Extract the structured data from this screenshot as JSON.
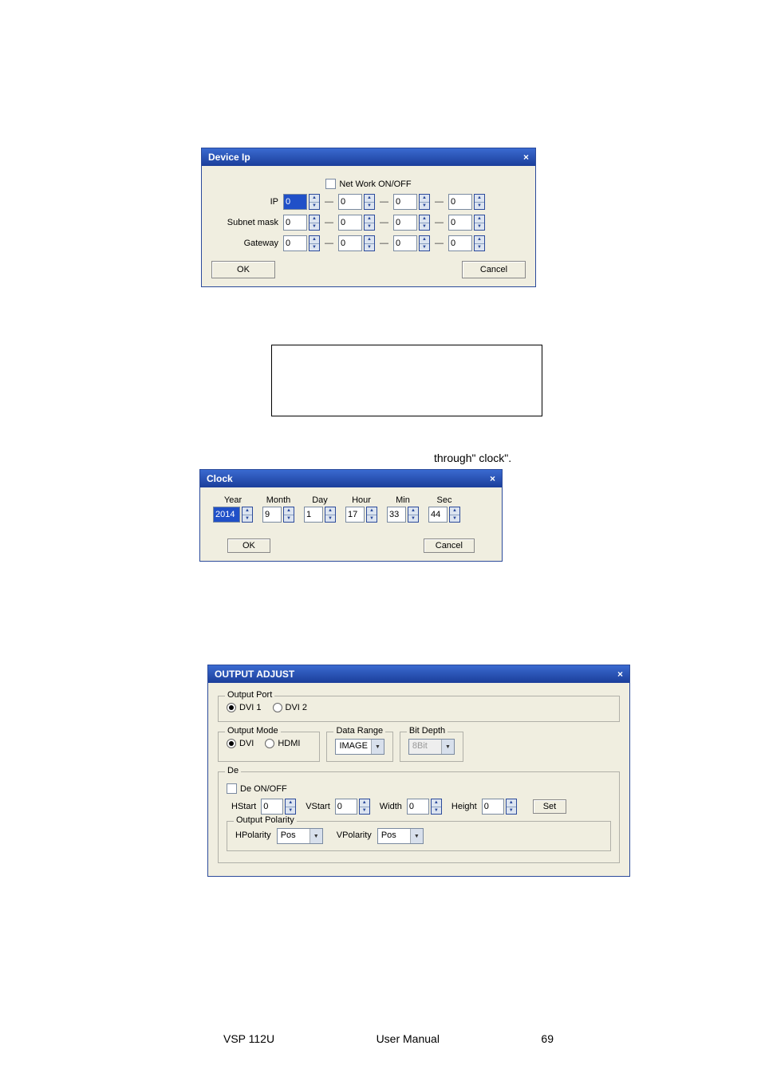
{
  "device_ip": {
    "title": "Device Ip",
    "network_label": "Net Work ON/OFF",
    "network_checked": false,
    "rows": [
      {
        "label": "IP",
        "values": [
          "0",
          "0",
          "0",
          "0"
        ],
        "highlight_first": true
      },
      {
        "label": "Subnet mask",
        "values": [
          "0",
          "0",
          "0",
          "0"
        ],
        "highlight_first": false
      },
      {
        "label": "Gateway",
        "values": [
          "0",
          "0",
          "0",
          "0"
        ],
        "highlight_first": false
      }
    ],
    "ok": "OK",
    "cancel": "Cancel"
  },
  "line_text": "through\" clock\".",
  "clock": {
    "title": "Clock",
    "cols": [
      {
        "label": "Year",
        "value": "2014",
        "highlight": true
      },
      {
        "label": "Month",
        "value": "9"
      },
      {
        "label": "Day",
        "value": "1"
      },
      {
        "label": "Hour",
        "value": "17"
      },
      {
        "label": "Min",
        "value": "33"
      },
      {
        "label": "Sec",
        "value": "44"
      }
    ],
    "ok": "OK",
    "cancel": "Cancel"
  },
  "output_adjust": {
    "title": "OUTPUT ADJUST",
    "output_port": {
      "legend": "Output Port",
      "options": [
        {
          "label": "DVI 1",
          "selected": true
        },
        {
          "label": "DVI 2",
          "selected": false
        }
      ]
    },
    "output_mode": {
      "legend": "Output Mode",
      "options": [
        {
          "label": "DVI",
          "selected": true
        },
        {
          "label": "HDMI",
          "selected": false
        }
      ]
    },
    "data_range": {
      "legend": "Data Range",
      "value": "IMAGE"
    },
    "bit_depth": {
      "legend": "Bit Depth",
      "value": "8Bit",
      "disabled": true
    },
    "de": {
      "legend": "De",
      "onoff_label": "De ON/OFF",
      "onoff_checked": false,
      "fields": [
        {
          "label": "HStart",
          "value": "0"
        },
        {
          "label": "VStart",
          "value": "0"
        },
        {
          "label": "Width",
          "value": "0"
        },
        {
          "label": "Height",
          "value": "0"
        }
      ],
      "set": "Set",
      "polarity": {
        "legend": "Output Polarity",
        "h_label": "HPolarity",
        "h_value": "Pos",
        "v_label": "VPolarity",
        "v_value": "Pos"
      }
    }
  },
  "footer": {
    "left": "VSP 112U",
    "center": "User Manual",
    "right": "69"
  }
}
